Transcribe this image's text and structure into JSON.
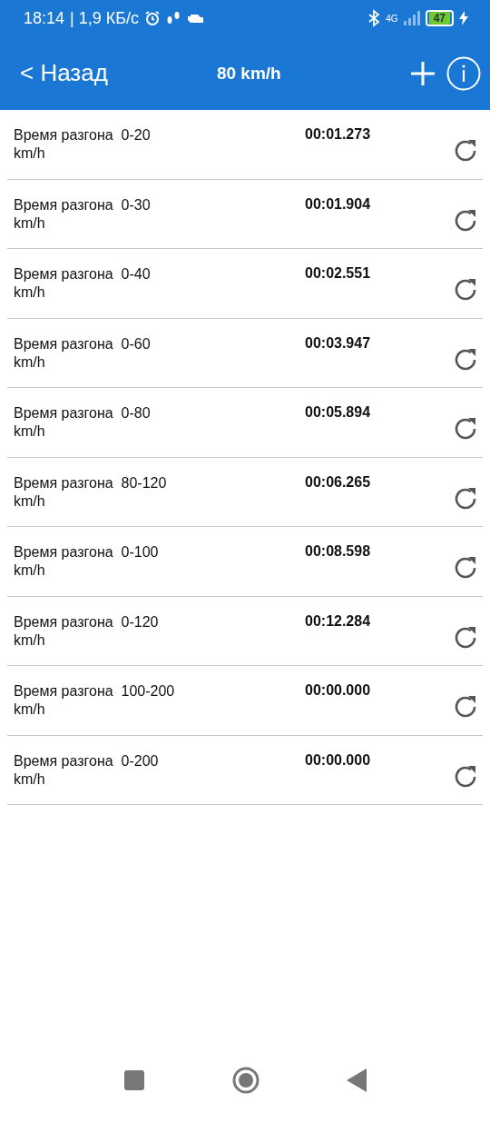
{
  "status_bar": {
    "time": "18:14",
    "speed": "| 1,9 КБ/с",
    "network": "4G",
    "battery": "47"
  },
  "header": {
    "back": "< Назад",
    "title": "80 km/h"
  },
  "rows": [
    {
      "label": "Время разгона  0-20 km/h",
      "time": "00:01.273"
    },
    {
      "label": "Время разгона  0-30 km/h",
      "time": "00:01.904"
    },
    {
      "label": "Время разгона  0-40 km/h",
      "time": "00:02.551"
    },
    {
      "label": "Время разгона  0-60 km/h",
      "time": "00:03.947"
    },
    {
      "label": "Время разгона  0-80 km/h",
      "time": "00:05.894"
    },
    {
      "label": "Время разгона  80-120 km/h",
      "time": "00:06.265"
    },
    {
      "label": "Время разгона  0-100 km/h",
      "time": "00:08.598"
    },
    {
      "label": "Время разгона  0-120 km/h",
      "time": "00:12.284"
    },
    {
      "label": "Время разгона  100-200 km/h",
      "time": "00:00.000"
    },
    {
      "label": "Время разгона  0-200 km/h",
      "time": "00:00.000"
    }
  ]
}
